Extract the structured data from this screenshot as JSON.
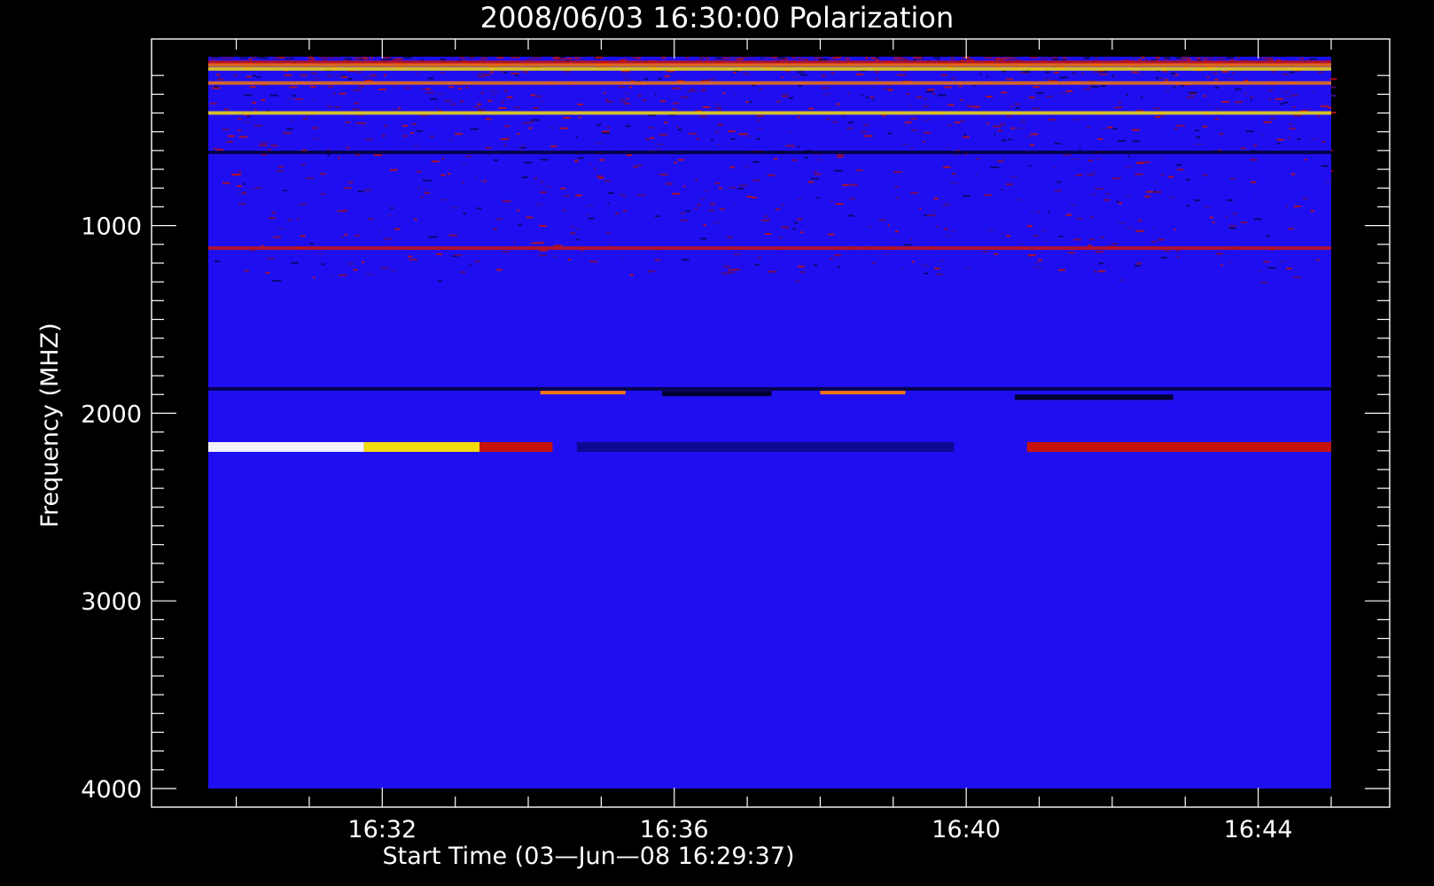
{
  "chart_data": {
    "type": "heatmap",
    "title": "2008/06/03 16:30:00 Polarization",
    "xlabel": "Start Time (03—Jun—08 16:29:37)",
    "ylabel": "Frequency (MHZ)",
    "x_range": [
      "16:29:37",
      "16:45:00"
    ],
    "y_range": [
      100,
      4000
    ],
    "y_reversed": true,
    "x_major_ticks": [
      "16:32",
      "16:36",
      "16:40",
      "16:44"
    ],
    "y_major_ticks": [
      1000,
      2000,
      3000,
      4000
    ],
    "grid": false,
    "colors": {
      "background": "#000000",
      "frame": "#ffffff",
      "base": "#1f0ff0",
      "band_black": "#000028",
      "band_dark_blue": "#0d0a8c",
      "band_red": "#d01400",
      "band_orange": "#ff7a00",
      "band_yellow": "#ffe800",
      "band_white": "#ffffff"
    },
    "features": [
      {
        "name": "interference-band",
        "freq": 130,
        "t_start": "16:29:37",
        "t_end": "16:45:00",
        "level": "red"
      },
      {
        "name": "interference-band",
        "freq": 145,
        "t_start": "16:29:37",
        "t_end": "16:45:00",
        "level": "orange"
      },
      {
        "name": "interference-band",
        "freq": 165,
        "t_start": "16:29:37",
        "t_end": "16:45:00",
        "level": "yellow"
      },
      {
        "name": "interference-band",
        "freq": 240,
        "t_start": "16:29:37",
        "t_end": "16:45:00",
        "level": "orange"
      },
      {
        "name": "interference-band",
        "freq": 400,
        "t_start": "16:29:37",
        "t_end": "16:45:00",
        "level": "yellow"
      },
      {
        "name": "interference-band",
        "freq": 610,
        "t_start": "16:29:37",
        "t_end": "16:45:00",
        "level": "black"
      },
      {
        "name": "interference-band",
        "freq": 1120,
        "t_start": "16:29:37",
        "t_end": "16:45:00",
        "level": "red"
      },
      {
        "name": "interference-band",
        "freq": 1870,
        "t_start": "16:29:37",
        "t_end": "16:45:00",
        "level": "black"
      },
      {
        "name": "polarized-burst",
        "freq": 1890,
        "t_start": "16:34:10",
        "t_end": "16:35:20",
        "level": "orange"
      },
      {
        "name": "polarized-burst",
        "freq": 1890,
        "t_start": "16:38:00",
        "t_end": "16:39:10",
        "level": "orange"
      },
      {
        "name": "depolarized-band",
        "freq": 1895,
        "t_start": "16:35:50",
        "t_end": "16:37:20",
        "level": "black"
      },
      {
        "name": "depolarized-band",
        "freq": 1915,
        "t_start": "16:40:40",
        "t_end": "16:42:50",
        "level": "black"
      },
      {
        "name": "polarized-band",
        "freq": 2180,
        "t_start": "16:29:37",
        "t_end": "16:31:45",
        "level": "white"
      },
      {
        "name": "polarized-band",
        "freq": 2180,
        "t_start": "16:31:45",
        "t_end": "16:33:20",
        "level": "yellow"
      },
      {
        "name": "polarized-band",
        "freq": 2180,
        "t_start": "16:33:20",
        "t_end": "16:34:20",
        "level": "red"
      },
      {
        "name": "depolarized-band",
        "freq": 2180,
        "t_start": "16:34:40",
        "t_end": "16:39:50",
        "level": "dark_blue"
      },
      {
        "name": "polarized-band",
        "freq": 2180,
        "t_start": "16:40:50",
        "t_end": "16:45:00",
        "level": "red"
      }
    ]
  }
}
